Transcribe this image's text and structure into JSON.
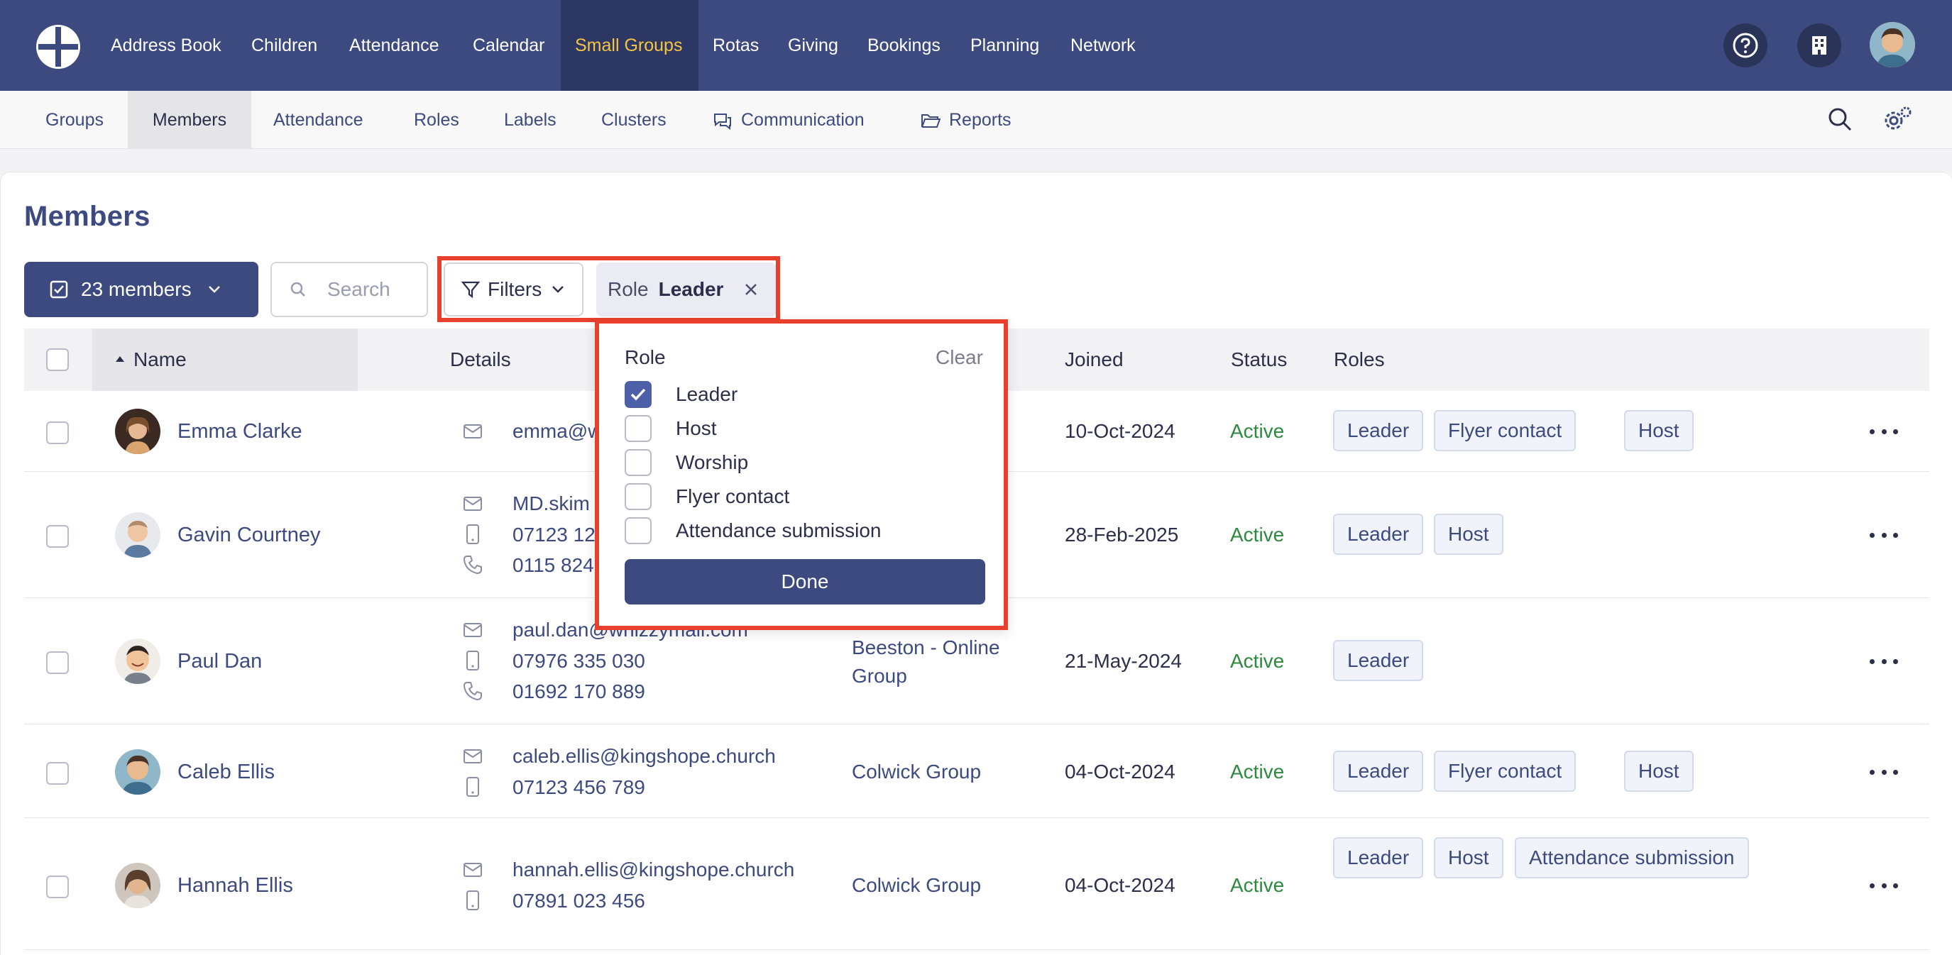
{
  "topnav": {
    "items": [
      "Address Book",
      "Children",
      "Attendance",
      "Calendar",
      "Small Groups",
      "Rotas",
      "Giving",
      "Bookings",
      "Planning",
      "Network"
    ],
    "active": "Small Groups",
    "icons": [
      "help-icon",
      "building-icon",
      "user-avatar"
    ]
  },
  "subnav": {
    "items": [
      "Groups",
      "Members",
      "Attendance",
      "Roles",
      "Labels",
      "Clusters",
      "Communication",
      "Reports"
    ],
    "active": "Members"
  },
  "page": {
    "title": "Members",
    "members_button": "23 members",
    "search_placeholder": "Search",
    "filters_label": "Filters",
    "chip": {
      "key": "Role",
      "value": "Leader"
    }
  },
  "table": {
    "headers": {
      "name": "Name",
      "details": "Details",
      "joined": "Joined",
      "status": "Status",
      "roles": "Roles"
    },
    "rows": [
      {
        "name": "Emma Clarke",
        "details": [
          "emma@w"
        ],
        "group": "",
        "joined": "10-Oct-2024",
        "status": "Active",
        "roles": [
          "Leader",
          "Flyer contact",
          "Host"
        ]
      },
      {
        "name": "Gavin Courtney",
        "details": [
          "MD.skim",
          "07123 12",
          "0115 824"
        ],
        "group": "",
        "joined": "28-Feb-2025",
        "status": "Active",
        "roles": [
          "Leader",
          "Host"
        ]
      },
      {
        "name": "Paul Dan",
        "details": [
          "paul.dan@whizzymail.com",
          "07976 335 030",
          "01692 170 889"
        ],
        "group_lines": [
          "Beeston - Online",
          "Group"
        ],
        "joined": "21-May-2024",
        "status": "Active",
        "roles": [
          "Leader"
        ]
      },
      {
        "name": "Caleb Ellis",
        "details": [
          "caleb.ellis@kingshope.church",
          "07123 456 789"
        ],
        "group": "Colwick Group",
        "joined": "04-Oct-2024",
        "status": "Active",
        "roles": [
          "Leader",
          "Flyer contact",
          "Host"
        ]
      },
      {
        "name": "Hannah Ellis",
        "details": [
          "hannah.ellis@kingshope.church",
          "07891 023 456"
        ],
        "group": "Colwick Group",
        "joined": "04-Oct-2024",
        "status": "Active",
        "roles": [
          "Leader",
          "Host",
          "Attendance submission"
        ]
      }
    ]
  },
  "dropdown": {
    "title": "Role",
    "clear": "Clear",
    "options": [
      {
        "label": "Leader",
        "checked": true
      },
      {
        "label": "Host",
        "checked": false
      },
      {
        "label": "Worship",
        "checked": false
      },
      {
        "label": "Flyer contact",
        "checked": false
      },
      {
        "label": "Attendance submission",
        "checked": false
      }
    ],
    "done": "Done"
  },
  "colors": {
    "primary": "#3d4a80",
    "accent": "#f5c542",
    "status_active": "#2c8a3f",
    "highlight": "#e8402c"
  }
}
